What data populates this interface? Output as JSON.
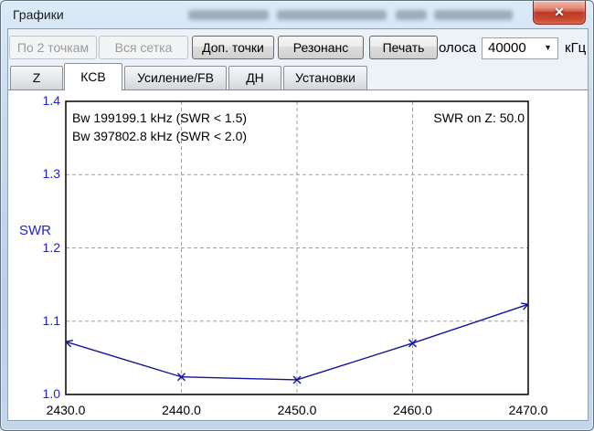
{
  "window": {
    "title": "Графики"
  },
  "icons": {
    "close": "✕",
    "dropdown": "▼"
  },
  "toolbar": {
    "buttons": [
      {
        "label": "По 2 точкам",
        "enabled": false
      },
      {
        "label": "Вся сетка",
        "enabled": false
      },
      {
        "label": "Доп. точки",
        "enabled": true
      },
      {
        "label": "Резонанс",
        "enabled": true
      },
      {
        "label": "Печать",
        "enabled": true
      }
    ],
    "bandwidth_label": "олоса",
    "bandwidth_value": "40000",
    "bandwidth_unit": "кГц"
  },
  "tabs": {
    "items": [
      {
        "label": "Z",
        "active": false
      },
      {
        "label": "КСВ",
        "active": true
      },
      {
        "label": "Усиление/FB",
        "active": false
      },
      {
        "label": "ДН",
        "active": false
      },
      {
        "label": "Установки",
        "active": false
      }
    ]
  },
  "chart_data": {
    "type": "line",
    "x": [
      2430.0,
      2440.0,
      2450.0,
      2460.0,
      2470.0
    ],
    "series": [
      {
        "name": "SWR",
        "values": [
          1.072,
          1.024,
          1.02,
          1.07,
          1.123
        ]
      }
    ],
    "title": "",
    "xlabel": "",
    "ylabel": "SWR",
    "xlim": [
      2430.0,
      2470.0
    ],
    "ylim": [
      1.0,
      1.4
    ],
    "x_ticks": [
      2430.0,
      2440.0,
      2450.0,
      2460.0,
      2470.0
    ],
    "x_tick_labels": [
      "2430.0",
      "2440.0",
      "2450.0",
      "2460.0",
      "2470.0"
    ],
    "y_ticks": [
      1.0,
      1.1,
      1.2,
      1.3,
      1.4
    ],
    "y_tick_labels": [
      "1.0",
      "1.1",
      "1.2",
      "1.3",
      "1.4"
    ],
    "grid": "dashed",
    "legend_position": "none",
    "annotations": [
      "Bw 199199.1 kHz (SWR < 1.5)",
      "Bw 397802.8 kHz (SWR < 2.0)"
    ],
    "annotation_right": "SWR on Z: 50.0",
    "line_color": "#14149b",
    "axis_label_color": "#2121d3",
    "tick_color_x": "#000000",
    "grid_color": "#9aa0a6"
  },
  "colors": {
    "frame": "#bfd5ea",
    "client_bg": "#edf2f9",
    "panel_bg": "#ffffff",
    "close_button": "#c64730"
  }
}
